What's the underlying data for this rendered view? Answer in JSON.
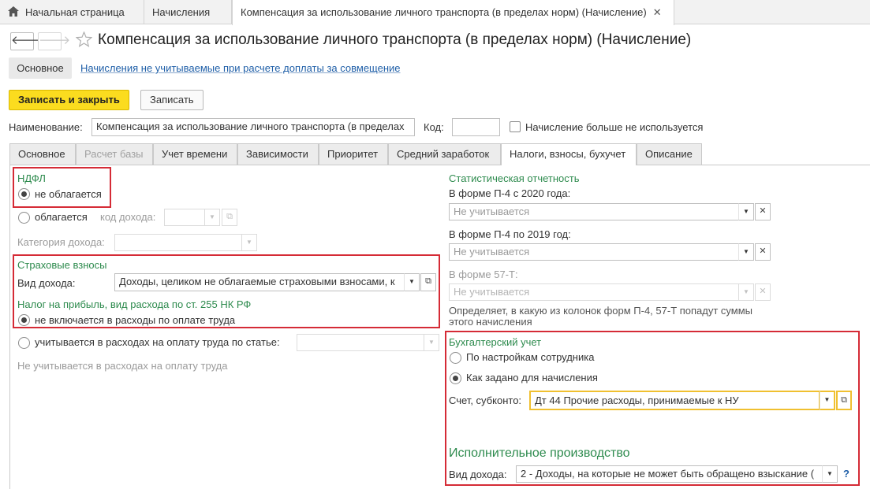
{
  "top_tabs": {
    "home": "Начальная страница",
    "accruals": "Начисления",
    "current": "Компенсация за использование личного транспорта (в пределах норм) (Начисление)"
  },
  "header": {
    "title": "Компенсация за использование личного транспорта (в пределах норм) (Начисление)"
  },
  "subnav": {
    "main": "Основное",
    "link": "Начисления не учитываемые при расчете доплаты за совмещение"
  },
  "toolbar": {
    "save_close": "Записать и закрыть",
    "save": "Записать"
  },
  "name_row": {
    "name_label": "Наименование:",
    "name_value": "Компенсация за использование личного транспорта (в пределах",
    "code_label": "Код:",
    "code_value": "",
    "unused_label": "Начисление больше не используется"
  },
  "form_tabs": [
    "Основное",
    "Расчет базы",
    "Учет времени",
    "Зависимости",
    "Приоритет",
    "Средний заработок",
    "Налоги, взносы, бухучет",
    "Описание"
  ],
  "left": {
    "ndfl_title": "НДФЛ",
    "not_taxed": "не облагается",
    "taxed": "облагается",
    "income_code_label": "код дохода:",
    "income_category_label": "Категория дохода:",
    "insurance_title": "Страховые взносы",
    "income_type_label": "Вид дохода:",
    "income_type_value": "Доходы, целиком не облагаемые страховыми взносами, к",
    "profit_tax_title": "Налог на прибыль, вид расхода по ст. 255 НК РФ",
    "not_included": "не включается в расходы по оплате труда",
    "included": "учитывается в расходах на оплату труда по статье:",
    "not_included_note": "Не учитывается в расходах на оплату труда"
  },
  "right": {
    "stat_title": "Статистическая отчетность",
    "p4_2020_label": "В форме П-4 с 2020 года:",
    "p4_2020_value": "Не учитывается",
    "p4_2019_label": "В форме П-4 по 2019 год:",
    "p4_2019_value": "Не учитывается",
    "f57_label": "В форме 57-Т:",
    "f57_value": "Не учитывается",
    "stat_note": "Определяет, в какую из колонок форм П-4, 57-Т попадут суммы этого начисления",
    "acc_title": "Бухгалтерский учет",
    "by_employee": "По настройкам сотрудника",
    "as_set": "Как задано для начисления",
    "account_label": "Счет, субконто:",
    "account_value": "Дт 44 Прочие расходы, принимаемые к НУ",
    "enforcement_title": "Исполнительное производство",
    "enf_income_label": "Вид дохода:",
    "enf_income_value": "2 - Доходы, на которые не может быть обращено взыскание (",
    "help": "?"
  },
  "colors": {
    "accent_yellow": "#fbdc1f",
    "highlight_red": "#d52b36",
    "group_green": "#2e8b4e",
    "link_blue": "#1f5fa8"
  }
}
